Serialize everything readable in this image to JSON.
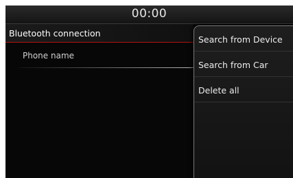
{
  "status_bar": {
    "time": "00:00"
  },
  "header": {
    "title": "Bluetooth connection"
  },
  "device_list": {
    "items": [
      {
        "label": "Phone name"
      }
    ]
  },
  "menu": {
    "items": [
      {
        "label": "Search from Device"
      },
      {
        "label": "Search from Car"
      },
      {
        "label": "Delete all"
      }
    ]
  }
}
